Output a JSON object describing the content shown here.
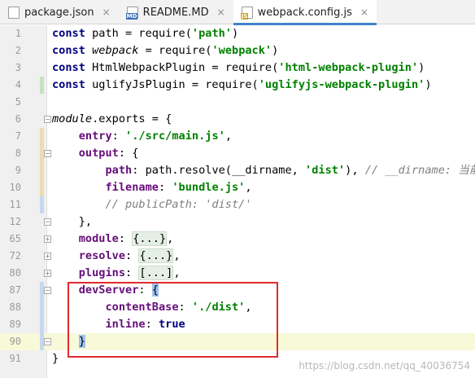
{
  "tabs": [
    {
      "label": "package.json",
      "icon": "json-file-icon",
      "badge": "",
      "close": "×",
      "active": false
    },
    {
      "label": "README.MD",
      "icon": "markdown-file-icon",
      "badge": "MD",
      "close": "×",
      "active": false
    },
    {
      "label": "webpack.config.js",
      "icon": "javascript-file-icon",
      "badge": "JS",
      "close": "×",
      "active": true
    }
  ],
  "lines": [
    {
      "num": "1",
      "parts": [
        [
          "kw",
          "const"
        ],
        [
          "",
          "path = "
        ],
        [
          "fn",
          "require"
        ],
        [
          "",
          "("
        ],
        [
          "str",
          "'path'"
        ],
        [
          "",
          ")"
        ]
      ]
    },
    {
      "num": "2",
      "parts": [
        [
          "kw",
          "const"
        ],
        [
          "ital",
          "webpack"
        ],
        [
          "",
          " = "
        ],
        [
          "fn",
          "require"
        ],
        [
          "",
          "("
        ],
        [
          "str",
          "'webpack'"
        ],
        [
          "",
          ")"
        ]
      ]
    },
    {
      "num": "3",
      "parts": [
        [
          "kw",
          "const"
        ],
        [
          "",
          "HtmlWebpackPlugin = "
        ],
        [
          "fn",
          "require"
        ],
        [
          "",
          "("
        ],
        [
          "str",
          "'html-webpack-plugin'"
        ],
        [
          "",
          ")"
        ]
      ]
    },
    {
      "num": "4",
      "parts": [
        [
          "kw",
          "const"
        ],
        [
          "",
          "uglifyJsPlugin = "
        ],
        [
          "fn",
          "require"
        ],
        [
          "",
          "("
        ],
        [
          "str",
          "'uglifyjs-webpack-plugin'"
        ],
        [
          "",
          ")"
        ]
      ]
    },
    {
      "num": "5",
      "parts": []
    },
    {
      "num": "6",
      "parts": [
        [
          "ital",
          "module"
        ],
        [
          "",
          ".exports = {"
        ]
      ]
    },
    {
      "num": "7",
      "parts": [
        [
          "",
          "    "
        ],
        [
          "prop",
          "entry"
        ],
        [
          "",
          ": "
        ],
        [
          "str",
          "'./src/main.js'"
        ],
        [
          "",
          ","
        ]
      ]
    },
    {
      "num": "8",
      "parts": [
        [
          "",
          "    "
        ],
        [
          "prop",
          "output"
        ],
        [
          "",
          ": {"
        ]
      ]
    },
    {
      "num": "9",
      "parts": [
        [
          "",
          "        "
        ],
        [
          "prop",
          "path"
        ],
        [
          "",
          ": path.resolve(__dirname, "
        ],
        [
          "str",
          "'dist'"
        ],
        [
          "",
          "), "
        ],
        [
          "cmt",
          "// __dirname: 当前文"
        ]
      ]
    },
    {
      "num": "10",
      "parts": [
        [
          "",
          "        "
        ],
        [
          "prop",
          "filename"
        ],
        [
          "",
          ": "
        ],
        [
          "str",
          "'bundle.js'"
        ],
        [
          "",
          ","
        ]
      ]
    },
    {
      "num": "11",
      "parts": [
        [
          "",
          "        "
        ],
        [
          "cmt",
          "// publicPath: 'dist/'"
        ]
      ]
    },
    {
      "num": "12",
      "parts": [
        [
          "",
          "    },"
        ]
      ]
    },
    {
      "num": "65",
      "parts": [
        [
          "",
          "    "
        ],
        [
          "prop",
          "module"
        ],
        [
          "",
          ": "
        ],
        [
          "fold",
          "{...}"
        ],
        [
          "",
          ","
        ]
      ]
    },
    {
      "num": "72",
      "parts": [
        [
          "",
          "    "
        ],
        [
          "prop",
          "resolve"
        ],
        [
          "",
          ": "
        ],
        [
          "fold",
          "{...}"
        ],
        [
          "",
          ","
        ]
      ]
    },
    {
      "num": "80",
      "parts": [
        [
          "",
          "    "
        ],
        [
          "prop",
          "plugins"
        ],
        [
          "",
          ": "
        ],
        [
          "fold",
          "[...]"
        ],
        [
          "",
          ","
        ]
      ]
    },
    {
      "num": "87",
      "parts": [
        [
          "",
          "    "
        ],
        [
          "prop",
          "devServer"
        ],
        [
          "",
          ": "
        ],
        [
          "brace",
          "{"
        ]
      ]
    },
    {
      "num": "88",
      "parts": [
        [
          "",
          "        "
        ],
        [
          "prop",
          "contentBase"
        ],
        [
          "",
          ": "
        ],
        [
          "str",
          "'./dist'"
        ],
        [
          "",
          ","
        ]
      ]
    },
    {
      "num": "89",
      "parts": [
        [
          "",
          "        "
        ],
        [
          "prop",
          "inline"
        ],
        [
          "",
          ": "
        ],
        [
          "kw",
          "true"
        ]
      ]
    },
    {
      "num": "90",
      "parts": [
        [
          "",
          "    "
        ],
        [
          "brace",
          "}"
        ]
      ]
    },
    {
      "num": "91",
      "parts": [
        [
          "",
          "}"
        ]
      ]
    }
  ],
  "watermark": "https://blog.csdn.net/qq_40036754"
}
